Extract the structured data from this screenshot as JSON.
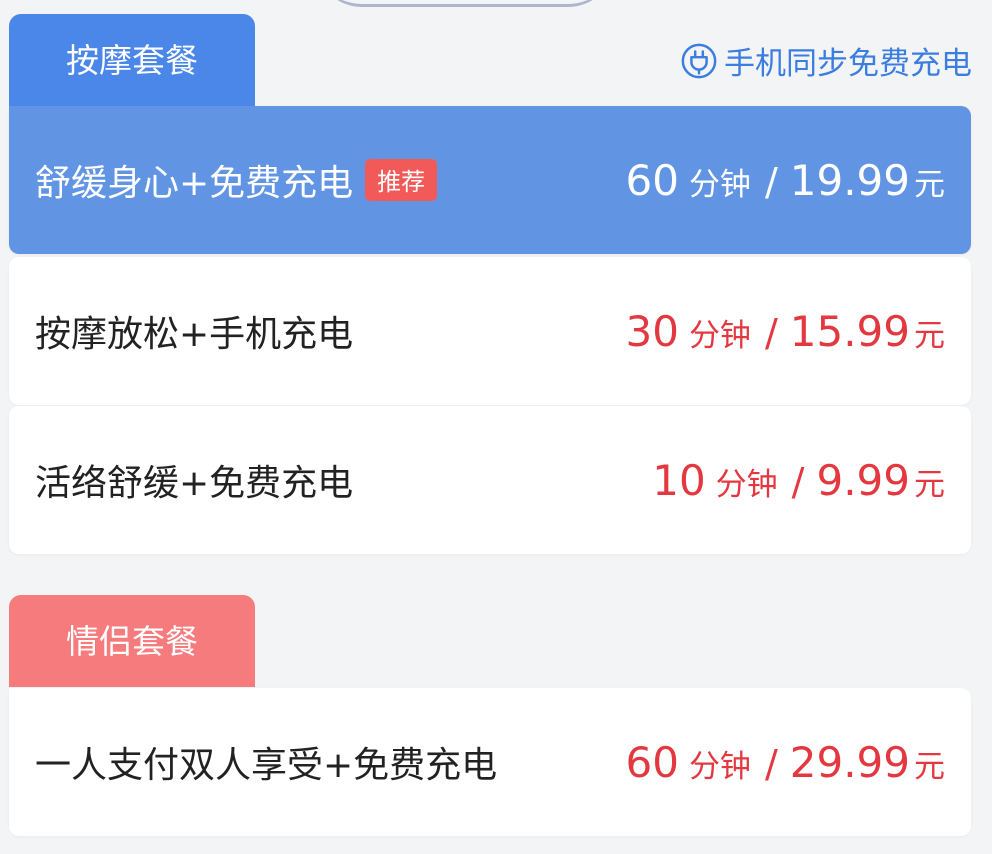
{
  "massage_section": {
    "tab_label": "按摩套餐",
    "sync_note": "手机同步免费充电",
    "packages": [
      {
        "name": "舒缓身心+免费充电",
        "badge": "推荐",
        "duration": "60",
        "duration_unit": "分钟",
        "separator": "/",
        "price": "19.99",
        "currency": "元",
        "selected": true
      },
      {
        "name": "按摩放松+手机充电",
        "duration": "30",
        "duration_unit": "分钟",
        "separator": "/",
        "price": "15.99",
        "currency": "元",
        "selected": false
      },
      {
        "name": "活络舒缓+免费充电",
        "duration": "10",
        "duration_unit": "分钟",
        "separator": "/",
        "price": "9.99",
        "currency": "元",
        "selected": false
      }
    ]
  },
  "couple_section": {
    "tab_label": "情侣套餐",
    "packages": [
      {
        "name": "一人支付双人享受+免费充电",
        "duration": "60",
        "duration_unit": "分钟",
        "separator": "/",
        "price": "29.99",
        "currency": "元",
        "selected": false
      }
    ]
  },
  "colors": {
    "massage_tab": "#4a87e8",
    "selected_card": "#6195e4",
    "couple_tab": "#f57b7d",
    "price_red": "#e3383f",
    "sync_blue": "#3c7de0",
    "badge_red": "#f25a5a"
  },
  "icons": {
    "sync_note": "charging-plug-icon"
  }
}
